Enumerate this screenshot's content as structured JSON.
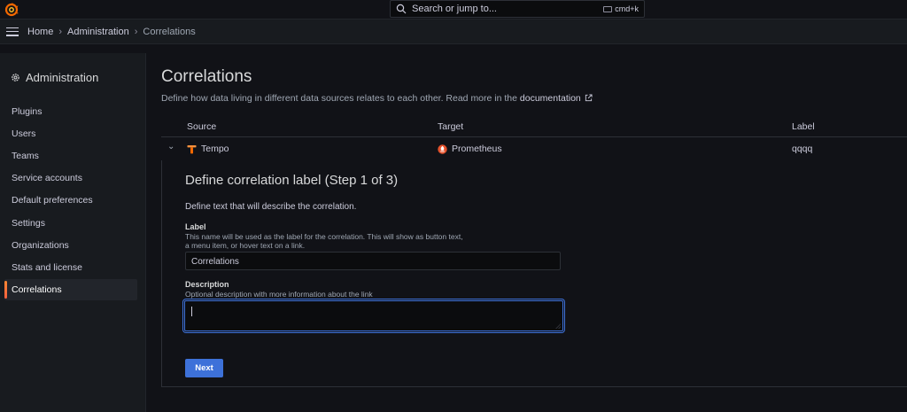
{
  "topbar": {
    "search_placeholder": "Search or jump to...",
    "search_shortcut": "cmd+k"
  },
  "breadcrumb": [
    "Home",
    "Administration",
    "Correlations"
  ],
  "sidebar": {
    "title": "Administration",
    "items": [
      {
        "label": "Plugins",
        "active": false
      },
      {
        "label": "Users",
        "active": false
      },
      {
        "label": "Teams",
        "active": false
      },
      {
        "label": "Service accounts",
        "active": false
      },
      {
        "label": "Default preferences",
        "active": false
      },
      {
        "label": "Settings",
        "active": false
      },
      {
        "label": "Organizations",
        "active": false
      },
      {
        "label": "Stats and license",
        "active": false
      },
      {
        "label": "Correlations",
        "active": true
      }
    ]
  },
  "page": {
    "title": "Correlations",
    "description": "Define how data living in different data sources relates to each other. Read more in the",
    "doc_link": "documentation"
  },
  "table": {
    "headers": {
      "source": "Source",
      "target": "Target",
      "label": "Label"
    },
    "row": {
      "source": "Tempo",
      "target": "Prometheus",
      "label": "qqqq"
    }
  },
  "form": {
    "step_title": "Define correlation label (Step 1 of 3)",
    "step_subtitle": "Define text that will describe the correlation.",
    "label_field": {
      "label": "Label",
      "description": "This name will be used as the label for the correlation. This will show as button text, a menu item, or hover text on a link.",
      "value": "Correlations"
    },
    "description_field": {
      "label": "Description",
      "description": "Optional description with more information about the link",
      "value": ""
    },
    "next_label": "Next"
  },
  "colors": {
    "primary": "#3d71d9",
    "accent": "#f55f3e",
    "background": "#111217",
    "panel": "#181b1f"
  }
}
